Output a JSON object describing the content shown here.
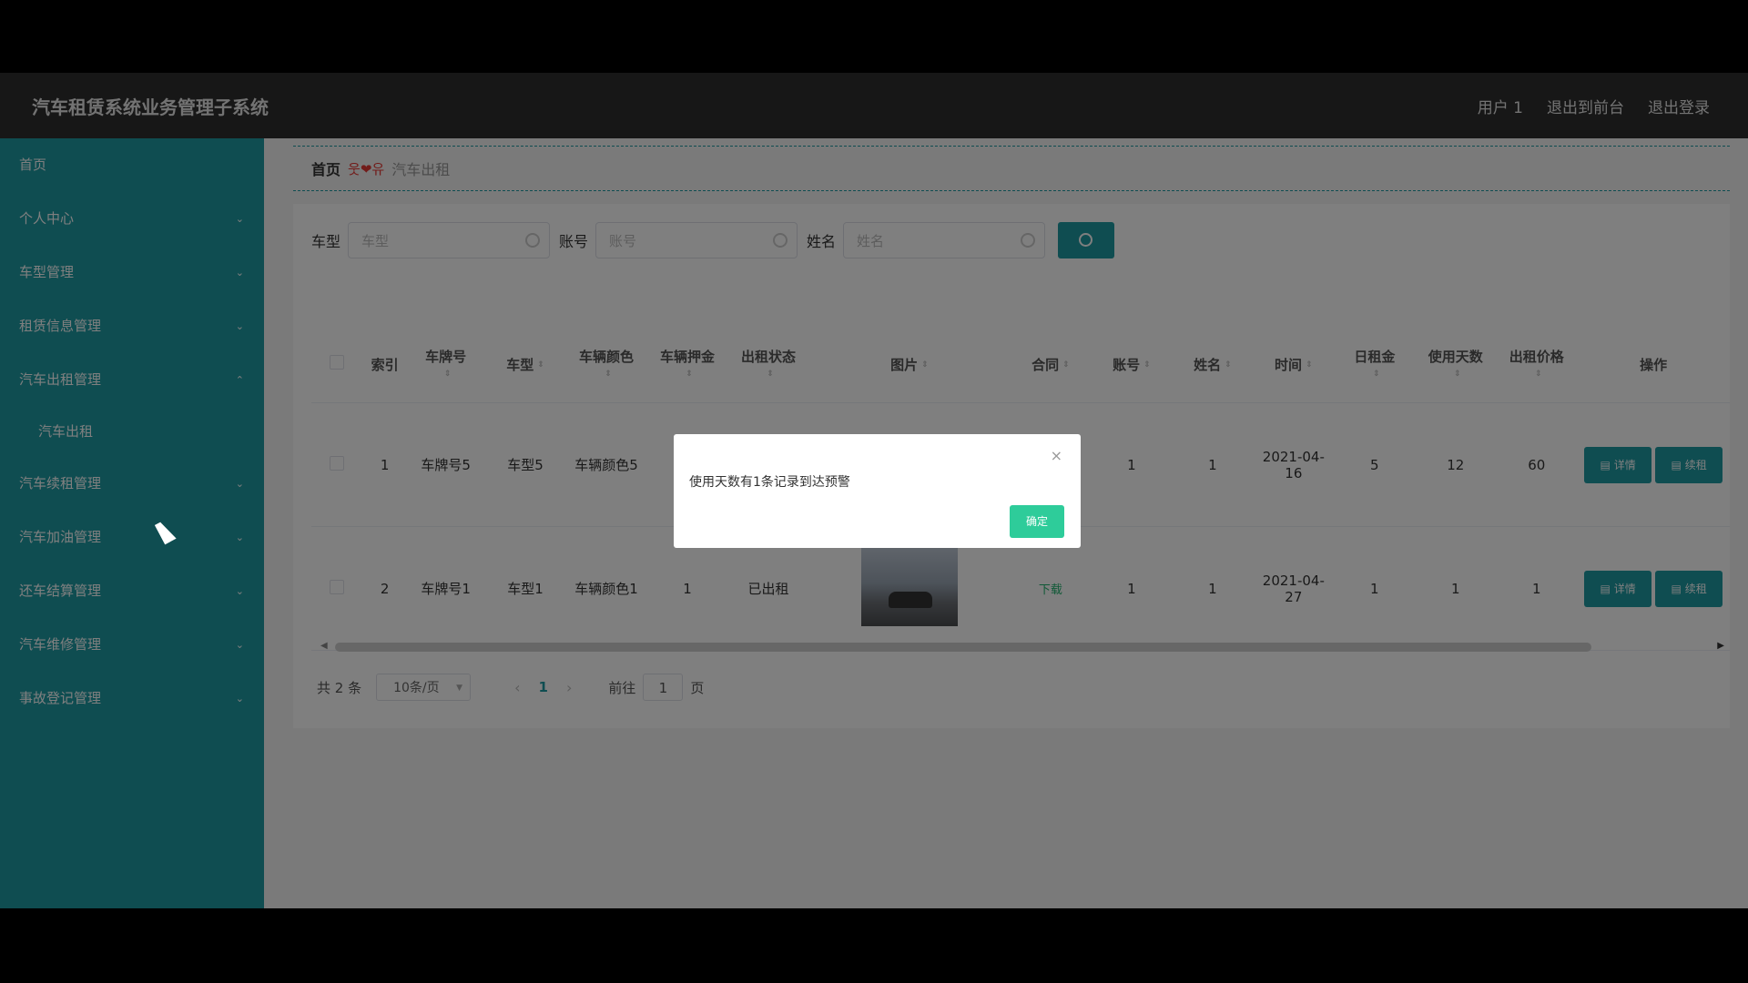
{
  "header": {
    "title": "汽车租赁系统业务管理子系统",
    "links": [
      "用户 1",
      "退出到前台",
      "退出登录"
    ]
  },
  "sidebar": {
    "items": [
      {
        "label": "首页",
        "chevron": ""
      },
      {
        "label": "个人中心",
        "chevron": "⌄"
      },
      {
        "label": "车型管理",
        "chevron": "⌄"
      },
      {
        "label": "租赁信息管理",
        "chevron": "⌄"
      },
      {
        "label": "汽车出租管理",
        "chevron": "⌃"
      },
      {
        "label": "汽车续租管理",
        "chevron": "⌄"
      },
      {
        "label": "汽车加油管理",
        "chevron": "⌄"
      },
      {
        "label": "还车结算管理",
        "chevron": "⌄"
      },
      {
        "label": "汽车维修管理",
        "chevron": "⌄"
      },
      {
        "label": "事故登记管理",
        "chevron": "⌄"
      }
    ],
    "subitem": "汽车出租"
  },
  "breadcrumb": {
    "home": "首页",
    "separator": "웃❤유",
    "current": "汽车出租"
  },
  "search": {
    "fields": [
      {
        "label": "车型",
        "placeholder": "车型"
      },
      {
        "label": "账号",
        "placeholder": "账号"
      },
      {
        "label": "姓名",
        "placeholder": "姓名"
      }
    ]
  },
  "table": {
    "headers": [
      "索引",
      "车牌号",
      "车型",
      "车辆颜色",
      "车辆押金",
      "出租状态",
      "图片",
      "合同",
      "账号",
      "姓名",
      "时间",
      "日租金",
      "使用天数",
      "出租价格",
      "操作"
    ],
    "rows": [
      {
        "index": "1",
        "plate": "车牌号5",
        "model": "车型5",
        "color": "车辆颜色5",
        "deposit": "",
        "status": "",
        "contract": "",
        "account": "1",
        "name": "1",
        "time": "2021-04-16",
        "daily": "5",
        "days": "12",
        "price": "60"
      },
      {
        "index": "2",
        "plate": "车牌号1",
        "model": "车型1",
        "color": "车辆颜色1",
        "deposit": "1",
        "status": "已出租",
        "contract": "下载",
        "account": "1",
        "name": "1",
        "time": "2021-04-27",
        "daily": "1",
        "days": "1",
        "price": "1"
      }
    ],
    "buttons": {
      "detail": "详情",
      "renew": "续租"
    }
  },
  "pagination": {
    "total": "共 2 条",
    "page_size": "10条/页",
    "current": "1",
    "goto_label": "前往",
    "goto_value": "1",
    "page_suffix": "页"
  },
  "dialog": {
    "message": "使用天数有1条记录到达预警",
    "ok": "确定",
    "close": "×"
  },
  "icons": {
    "search": "search-icon",
    "close": "close-icon",
    "chevron": "chevron-icon"
  },
  "colors": {
    "accent": "#1e9aa3",
    "header_bg": "#2e2e2e",
    "ok_button": "#2ecc9a"
  }
}
